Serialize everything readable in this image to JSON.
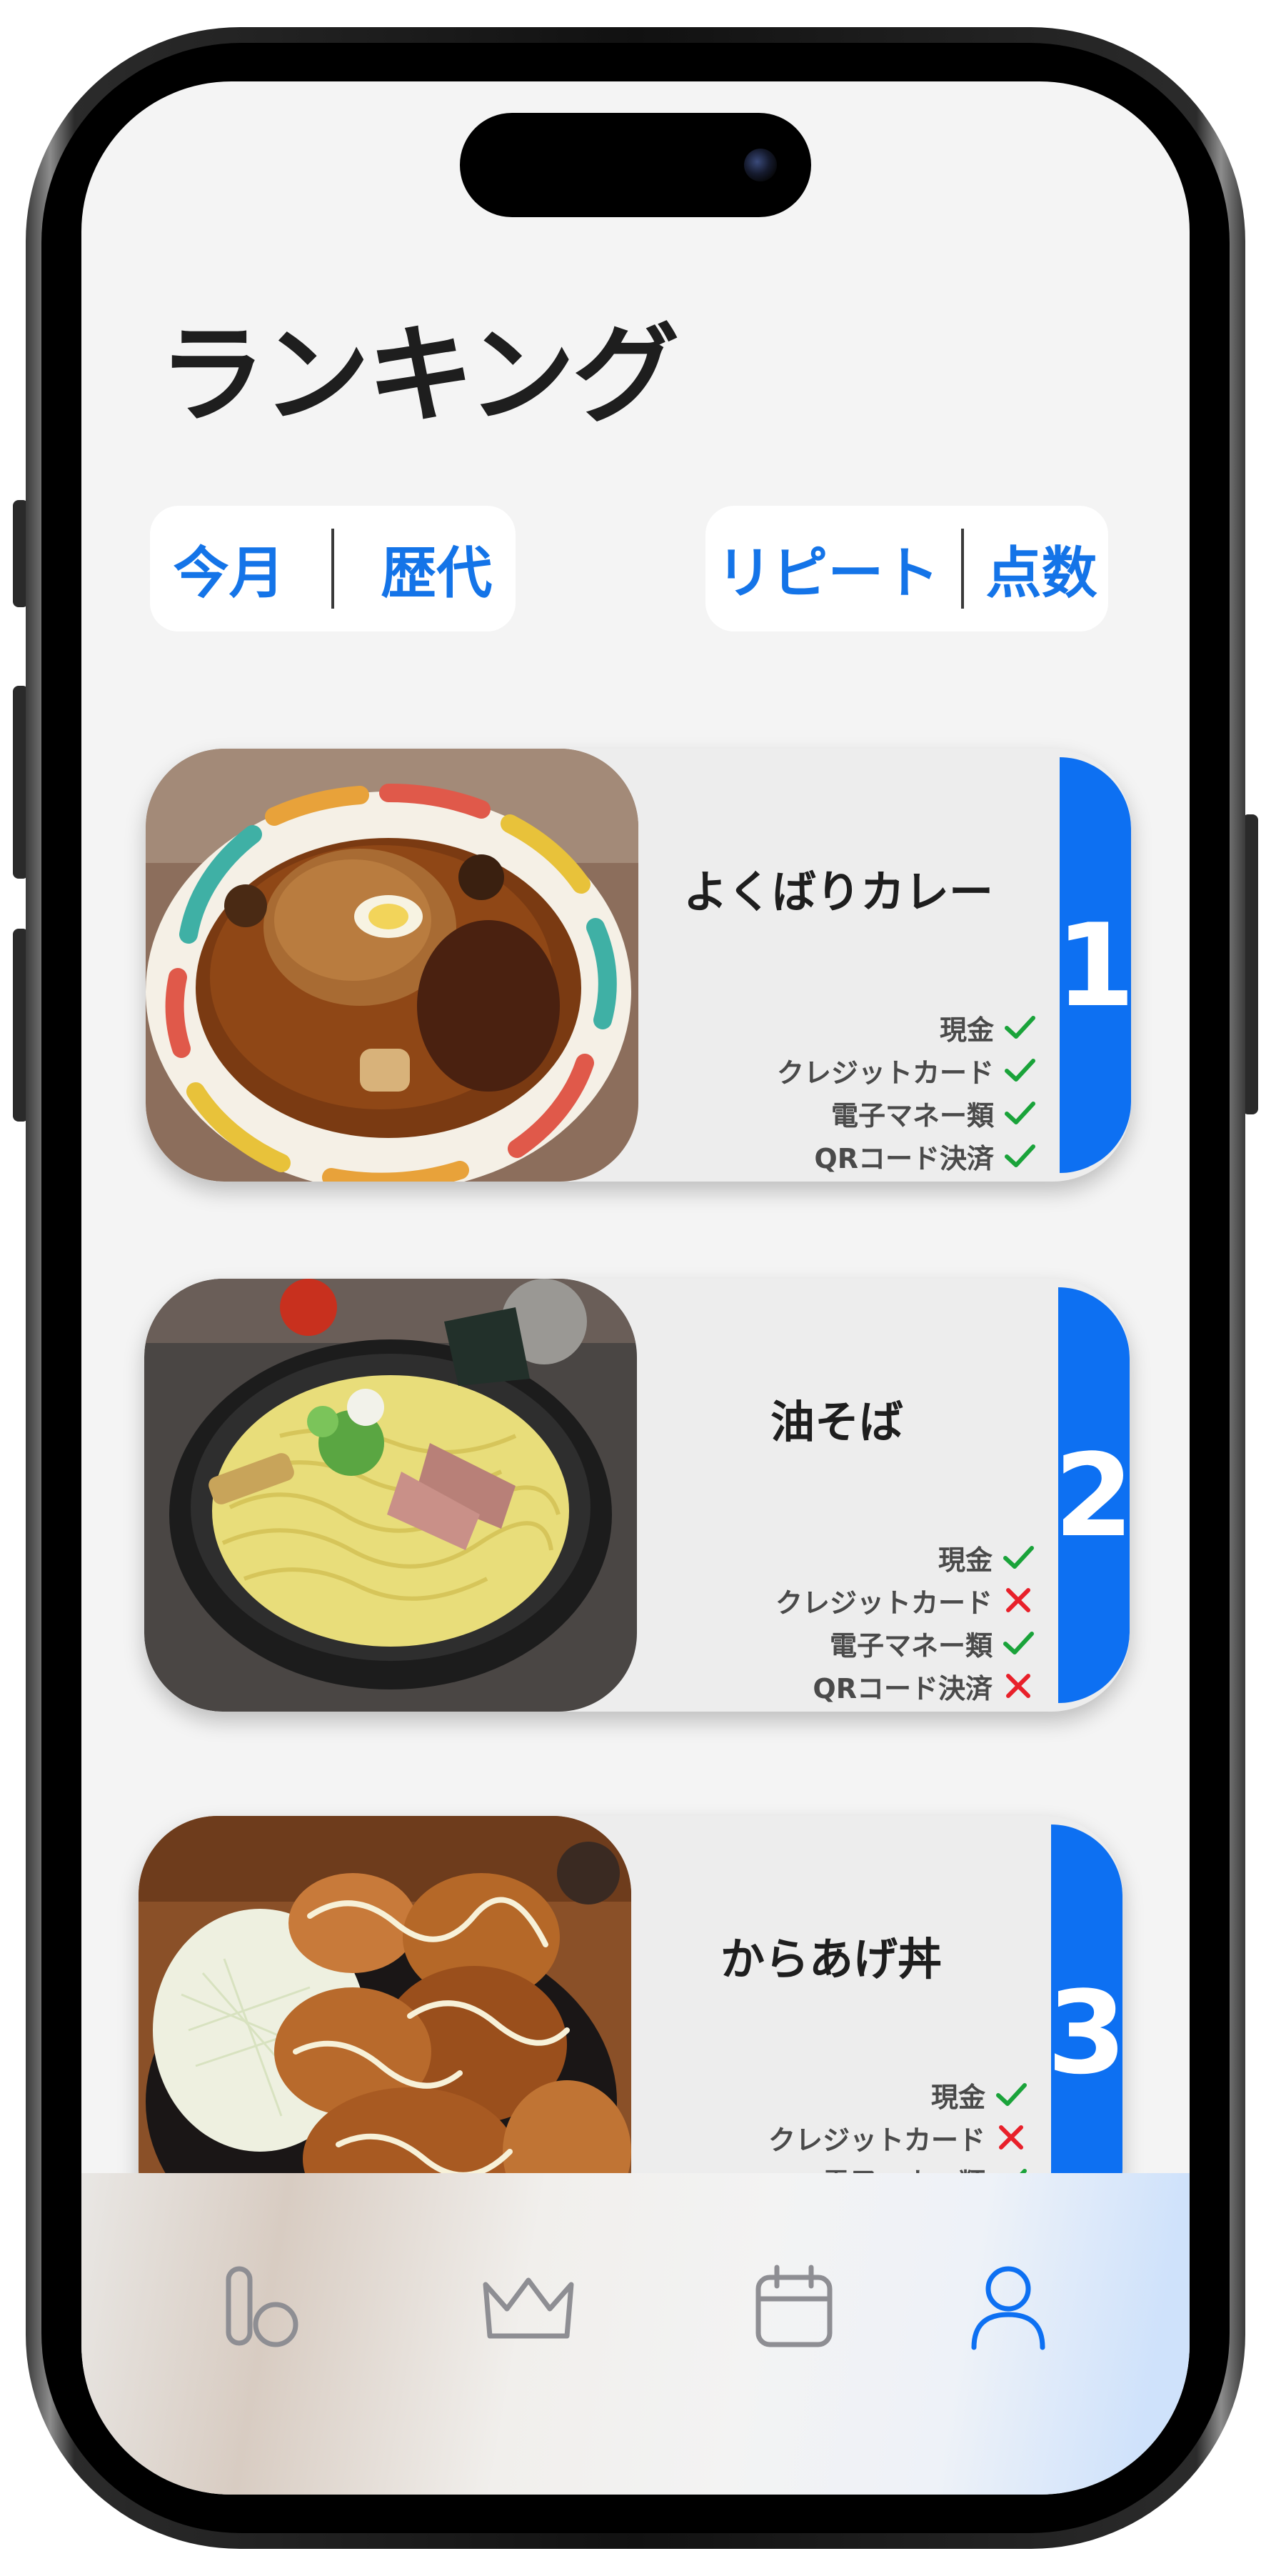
{
  "header": {
    "title": "ランキング"
  },
  "period_toggle": {
    "options": [
      "今月",
      "歴代"
    ]
  },
  "sort_toggle": {
    "options": [
      "リピート",
      "点数"
    ]
  },
  "payment_labels": [
    "現金",
    "クレジットカード",
    "電子マネー類",
    "QRコード決済"
  ],
  "colors": {
    "accent": "#0d70f2",
    "check": "#1aa33a",
    "cross": "#e8202a"
  },
  "ranking": [
    {
      "rank": "1",
      "name": "よくばりカレー",
      "photo_icon": "curry-photo",
      "payments": {
        "現金": true,
        "クレジットカード": true,
        "電子マネー類": true,
        "QRコード決済": true
      }
    },
    {
      "rank": "2",
      "name": "油そば",
      "photo_icon": "noodle-photo",
      "payments": {
        "現金": true,
        "クレジットカード": false,
        "電子マネー類": true,
        "QRコード決済": false
      }
    },
    {
      "rank": "3",
      "name": "からあげ丼",
      "photo_icon": "karaage-photo",
      "payments": {
        "現金": true,
        "クレジットカード": false,
        "電子マネー類": true
      }
    }
  ],
  "tab_bar": {
    "tabs": [
      {
        "icon": "rating-icon",
        "active": false
      },
      {
        "icon": "crown-icon",
        "active": false
      },
      {
        "icon": "calendar-icon",
        "active": false
      },
      {
        "icon": "profile-icon",
        "active": true
      }
    ]
  }
}
